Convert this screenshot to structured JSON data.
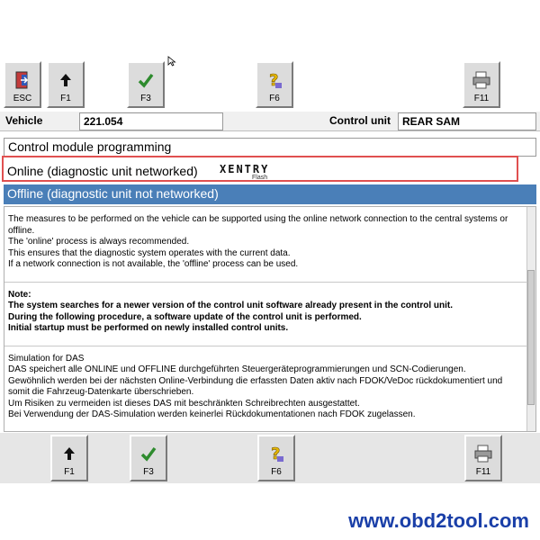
{
  "toolbar_top": {
    "buttons": [
      {
        "label": "ESC",
        "icon": "exit-door-icon"
      },
      {
        "label": "F1",
        "icon": "arrow-up-icon"
      },
      {
        "label": "F3",
        "icon": "checkmark-icon"
      },
      {
        "label": "F6",
        "icon": "question-help-icon"
      },
      {
        "label": "F11",
        "icon": "printer-icon"
      }
    ]
  },
  "vehicle_bar": {
    "vehicle_label": "Vehicle",
    "vehicle_value": "221.054",
    "control_unit_label": "Control unit",
    "control_unit_value": "REAR SAM"
  },
  "list": {
    "header": "Control module programming",
    "online_option": "Online (diagnostic unit networked)",
    "offline_option": "Offline (diagnostic unit not networked)",
    "logo_text": "XENTRY",
    "logo_sub": "Flash"
  },
  "content": {
    "intro": [
      "The measures to be performed on the vehicle can be supported using the online network connection to the central systems or offline.",
      "The 'online' process is always recommended.",
      "This ensures that the diagnostic system operates with the current data.",
      "If a network connection is not available, the 'offline' process can be used."
    ],
    "note": [
      "Note:",
      "The system searches for a newer version of the control unit software already present in the control unit.",
      "During the following procedure, a software update of the control unit is performed.",
      "Initial startup must be performed on newly installed control units."
    ],
    "simulation": [
      "Simulation for DAS",
      "DAS speichert alle ONLINE und OFFLINE durchgeführten Steuergeräteprogrammierungen und SCN-Codierungen.",
      "Gewöhnlich werden bei der nächsten Online-Verbindung die erfassten Daten aktiv nach FDOK/VeDoc rückdokumentiert und somit die Fahrzeug-Datenkarte überschrieben.",
      "Um Risiken zu vermeiden ist dieses DAS mit beschränkten Schreibrechten ausgestattet.",
      "Bei Verwendung der DAS-Simulation werden keinerlei Rückdokumentationen nach FDOK zugelassen."
    ]
  },
  "toolbar_bottom": {
    "buttons": [
      {
        "label": "F1",
        "icon": "arrow-up-icon"
      },
      {
        "label": "F3",
        "icon": "checkmark-icon"
      },
      {
        "label": "F6",
        "icon": "question-help-icon"
      },
      {
        "label": "F11",
        "icon": "printer-icon"
      }
    ]
  },
  "watermark": "www.obd2tool.com",
  "colors": {
    "selected_bg": "#4a7fb8",
    "highlight_border": "#e05050",
    "url_color": "#1a3fa8"
  }
}
